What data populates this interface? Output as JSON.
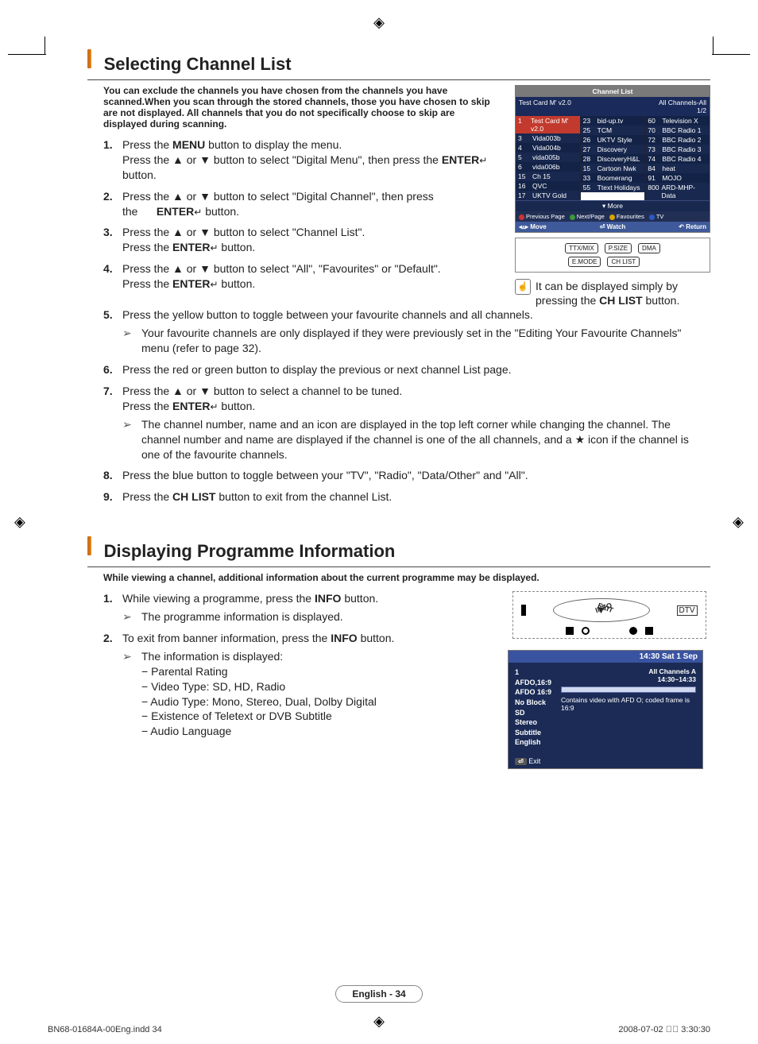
{
  "section1": {
    "title": "Selecting Channel List",
    "intro": "You can exclude the channels you have chosen from the channels you have scanned.When you scan through the stored channels, those you have chosen to skip are not displayed. All channels that you do not specifically choose to skip are displayed during scanning.",
    "steps": {
      "s1a": "Press the ",
      "s1b": " button to display the menu.",
      "s1c": "Press the ▲ or ▼ button to select \"Digital Menu\", then press the ",
      "s1d": " button.",
      "s2a": "Press the ▲ or ▼ button to select \"Digital Channel\", then press the",
      "s2c": " button.",
      "s3a": "Press the ▲ or ▼ button to select \"Channel List\".",
      "s3b": "Press the ",
      "s3d": " button.",
      "s4a": "Press the ▲ or ▼ button to select \"All\", \"Favourites\" or \"Default\".",
      "s4b": "Press the ",
      "s4d": " button.",
      "s5a": "Press the yellow button to toggle between your favourite channels and all channels.",
      "s5sub": "Your favourite channels are only displayed if they were previously set in the \"Editing Your Favourite Channels\" menu (refer to page 32).",
      "s6": "Press the red or green button to display the previous or next channel List page.",
      "s7a": "Press the ▲ or ▼ button to select a channel to be tuned.",
      "s7b": "Press the ",
      "s7d": " button.",
      "s7sub": "The channel number, name and an icon are displayed in the top left corner while changing the channel. The channel number and name are displayed if the channel is one of the all channels, and a ★ icon if the channel is one of the favourite channels.",
      "s8": "Press the blue button to toggle between your \"TV\", \"Radio\", \"Data/Other\" and \"All\".",
      "s9a": "Press the ",
      "s9c": " button to exit from the channel List."
    },
    "kb": {
      "menu": "MENU",
      "enter": "ENTER",
      "chlist": "CH LIST"
    },
    "enter_glyph": "↵",
    "tvshot": {
      "title": "Channel List",
      "meta_left": "Test Card M' v2.0",
      "meta_right_top": "All Channels-All",
      "meta_right_bottom": "1/2",
      "col1": [
        {
          "n": "1",
          "t": "Test Card M' v2.0",
          "sel": true
        },
        {
          "n": "3",
          "t": "Vida003b"
        },
        {
          "n": "4",
          "t": "Vida004b"
        },
        {
          "n": "5",
          "t": "vida005b"
        },
        {
          "n": "6",
          "t": "vida006b"
        },
        {
          "n": "15",
          "t": "Ch 15"
        },
        {
          "n": "16",
          "t": "QVC"
        },
        {
          "n": "17",
          "t": "UKTV Gold"
        }
      ],
      "col2": [
        {
          "n": "23",
          "t": "bid-up.tv"
        },
        {
          "n": "25",
          "t": "TCM"
        },
        {
          "n": "26",
          "t": "UKTV Style"
        },
        {
          "n": "27",
          "t": "Discovery"
        },
        {
          "n": "28",
          "t": "DiscoveryH&L"
        },
        {
          "n": "15",
          "t": "Cartoon Nwk"
        },
        {
          "n": "33",
          "t": "Boomerang"
        },
        {
          "n": "55",
          "t": "Ttext Holidays"
        }
      ],
      "col3": [
        {
          "n": "60",
          "t": "Television X"
        },
        {
          "n": "70",
          "t": "BBC Radio 1"
        },
        {
          "n": "72",
          "t": "BBC Radio 2"
        },
        {
          "n": "73",
          "t": "BBC Radio 3"
        },
        {
          "n": "74",
          "t": "BBC Radio 4"
        },
        {
          "n": "84",
          "t": "heat"
        },
        {
          "n": "91",
          "t": "MOJO"
        },
        {
          "n": "800",
          "t": "ARD-MHP-Data"
        }
      ],
      "more": "▾  More",
      "legend": {
        "prev": "Previous Page",
        "next": "Next/Page",
        "fav": "Favourites",
        "tv": "TV"
      },
      "bar": {
        "move": "◂▵▸ Move",
        "watch": "⏎ Watch",
        "ret": "↶ Return"
      }
    },
    "remote_buttons": {
      "r1": [
        "TTX/MIX",
        "P.SIZE",
        "DMA"
      ],
      "r2": [
        "E.MODE",
        "CH LIST",
        ""
      ]
    },
    "note": "It can be displayed simply by pressing the CH LIST button."
  },
  "section2": {
    "title": "Displaying Programme Information",
    "intro": "While viewing a channel, additional information about the current programme may be displayed.",
    "s1a": "While viewing a programme, press the ",
    "s1c": " button.",
    "s1sub": "The programme information is displayed.",
    "s2a": "To exit from banner information, press the ",
    "s2c": " button.",
    "s2sub_head": "The information is displayed:",
    "info_items": [
      "− Parental Rating",
      "− Video Type: SD, HD, Radio",
      "− Audio Type: Mono, Stereo, Dual, Dolby Digital",
      "− Existence of Teletext or DVB Subtitle",
      "− Audio Language"
    ],
    "kb": {
      "info": "INFO"
    },
    "remote": {
      "info": "INFO",
      "exit": "EXIT",
      "logo": "DTV"
    },
    "panel": {
      "time": "14:30 Sat 1 Sep",
      "left": [
        "1 AFDO,16:9",
        "AFDO 16:9",
        "No Block",
        "SD",
        "Stereo",
        "Subtitle",
        "English"
      ],
      "right_top": "All Channels    A",
      "right_time": "14:30~14:33",
      "desc": "Contains video with AFD O; coded frame is 16:9",
      "exit": "Exit"
    }
  },
  "footer": "English - 34",
  "printmeta": {
    "left": "BN68-01684A-00Eng.indd   34",
    "right": "2008-07-02   ￿￿ 3:30:30"
  }
}
